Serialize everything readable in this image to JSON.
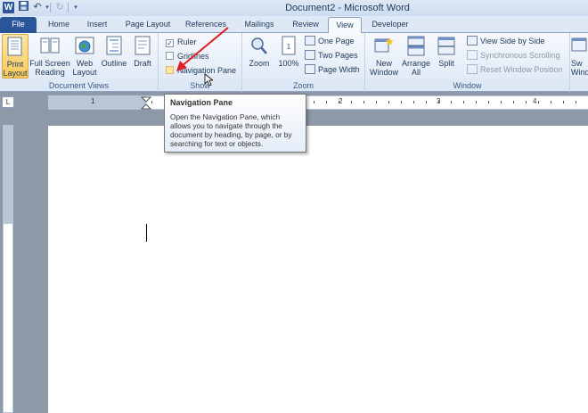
{
  "window": {
    "title": "Document2  -  Microsoft Word",
    "app_icon_letter": "W"
  },
  "quick_access": {
    "save_icon": "save-icon",
    "undo_icon": "undo-icon",
    "redo_icon": "redo-icon"
  },
  "tabs": [
    {
      "label": "File"
    },
    {
      "label": "Home"
    },
    {
      "label": "Insert"
    },
    {
      "label": "Page Layout"
    },
    {
      "label": "References"
    },
    {
      "label": "Mailings"
    },
    {
      "label": "Review"
    },
    {
      "label": "View"
    },
    {
      "label": "Developer"
    }
  ],
  "ribbon": {
    "document_views": {
      "label": "Document Views",
      "buttons": [
        {
          "label": "Print Layout"
        },
        {
          "label": "Full Screen Reading"
        },
        {
          "label": "Web Layout"
        },
        {
          "label": "Outline"
        },
        {
          "label": "Draft"
        }
      ]
    },
    "show": {
      "label": "Show",
      "items": [
        {
          "label": "Ruler",
          "checked": true
        },
        {
          "label": "Gridlines",
          "checked": false
        },
        {
          "label": "Navigation Pane",
          "checked": false
        }
      ]
    },
    "zoom": {
      "label": "Zoom",
      "zoom_label": "Zoom",
      "percent_label": "100%",
      "one_page": "One Page",
      "two_pages": "Two Pages",
      "page_width": "Page Width"
    },
    "window": {
      "label": "Window",
      "new_window": "New Window",
      "arrange_all": "Arrange All",
      "split": "Split",
      "view_side_by_side": "View Side by Side",
      "synchronous_scrolling": "Synchronous Scrolling",
      "reset_window_position": "Reset Window Position",
      "switch_windows": "Sw Windo"
    }
  },
  "ruler": {
    "tab_selector": "L",
    "numbers": [
      "1",
      "1",
      "2",
      "3",
      "4"
    ]
  },
  "tooltip": {
    "title": "Navigation Pane",
    "body": "Open the Navigation Pane, which allows you to navigate through the document by heading, by page, or by searching for text or objects."
  },
  "colors": {
    "file_tab": "#2a5699",
    "arrow": "#e02020",
    "selected_button": "#f8c95a"
  }
}
